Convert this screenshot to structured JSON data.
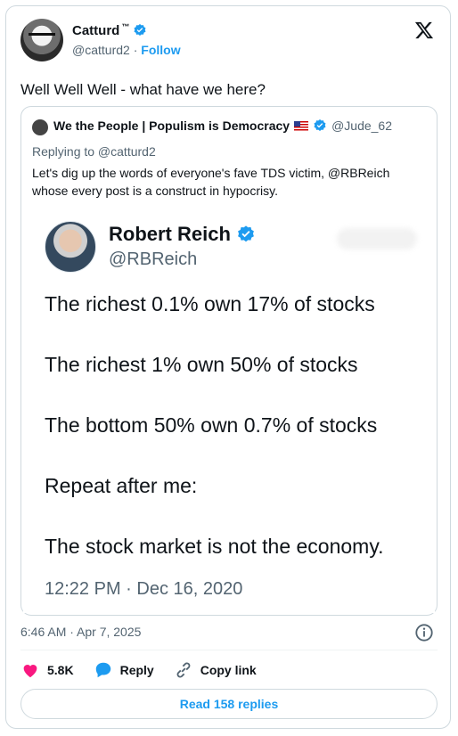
{
  "author": {
    "name": "Catturd",
    "tm": "™",
    "handle": "@catturd2",
    "separator": "·",
    "follow_label": "Follow"
  },
  "tweet": {
    "text": "Well Well Well - what have we here?",
    "timestamp": "6:46 AM · Apr 7, 2025"
  },
  "quote": {
    "name": "We the People | Populism is Democracy",
    "handle": "@Jude_62",
    "replying_to": "Replying to @catturd2",
    "text": "Let's dig up the words of everyone's fave TDS victim, @RBReich whose every post is a construct in hypocrisy."
  },
  "image": {
    "name": "Robert Reich",
    "handle": "@RBReich",
    "lines": [
      "The richest 0.1% own 17% of stocks",
      "The richest 1% own 50% of stocks",
      "The bottom 50% own 0.7% of stocks",
      "Repeat after me:",
      "The stock market is not the economy."
    ],
    "time": "12:22 PM · Dec 16, 2020"
  },
  "actions": {
    "likes": "5.8K",
    "reply_label": "Reply",
    "copy_label": "Copy link",
    "read_replies_label": "Read 158 replies"
  },
  "colors": {
    "accent": "#1d9bf0",
    "like": "#f91880",
    "muted": "#536471"
  },
  "icons": [
    "verified-badge-icon",
    "x-logo-icon",
    "flag-icon",
    "info-icon",
    "heart-icon",
    "reply-bubble-icon",
    "link-icon"
  ]
}
